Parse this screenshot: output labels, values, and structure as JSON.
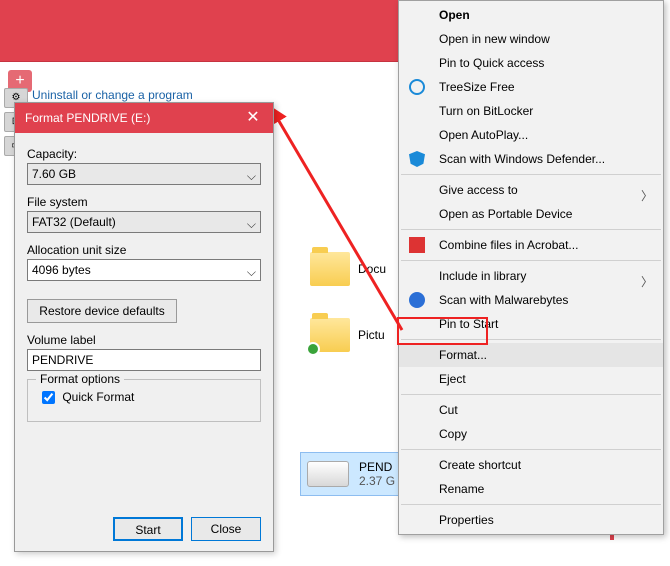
{
  "window": {
    "uninstall_link": "Uninstall or change a program"
  },
  "format": {
    "title": "Format PENDRIVE (E:)",
    "capacity_label": "Capacity:",
    "capacity_value": "7.60 GB",
    "fs_label": "File system",
    "fs_value": "FAT32 (Default)",
    "alloc_label": "Allocation unit size",
    "alloc_value": "4096 bytes",
    "restore_btn": "Restore device defaults",
    "vol_label": "Volume label",
    "vol_value": "PENDRIVE",
    "options_legend": "Format options",
    "quick_format": "Quick Format",
    "start_btn": "Start",
    "close_btn": "Close"
  },
  "explorer": {
    "folder1": "Docu",
    "folder2": "Pictu",
    "drive_name": "PEND",
    "drive_sub": "2.37 G"
  },
  "menu": {
    "open": "Open",
    "open_new": "Open in new window",
    "pin_qa": "Pin to Quick access",
    "treesize": "TreeSize Free",
    "bitlocker": "Turn on BitLocker",
    "autoplay": "Open AutoPlay...",
    "defender": "Scan with Windows Defender...",
    "give_access": "Give access to",
    "portable": "Open as Portable Device",
    "acrobat": "Combine files in Acrobat...",
    "library": "Include in library",
    "malwarebytes": "Scan with Malwarebytes",
    "pin_start": "Pin to Start",
    "format": "Format...",
    "eject": "Eject",
    "cut": "Cut",
    "copy": "Copy",
    "shortcut": "Create shortcut",
    "rename": "Rename",
    "properties": "Properties"
  }
}
